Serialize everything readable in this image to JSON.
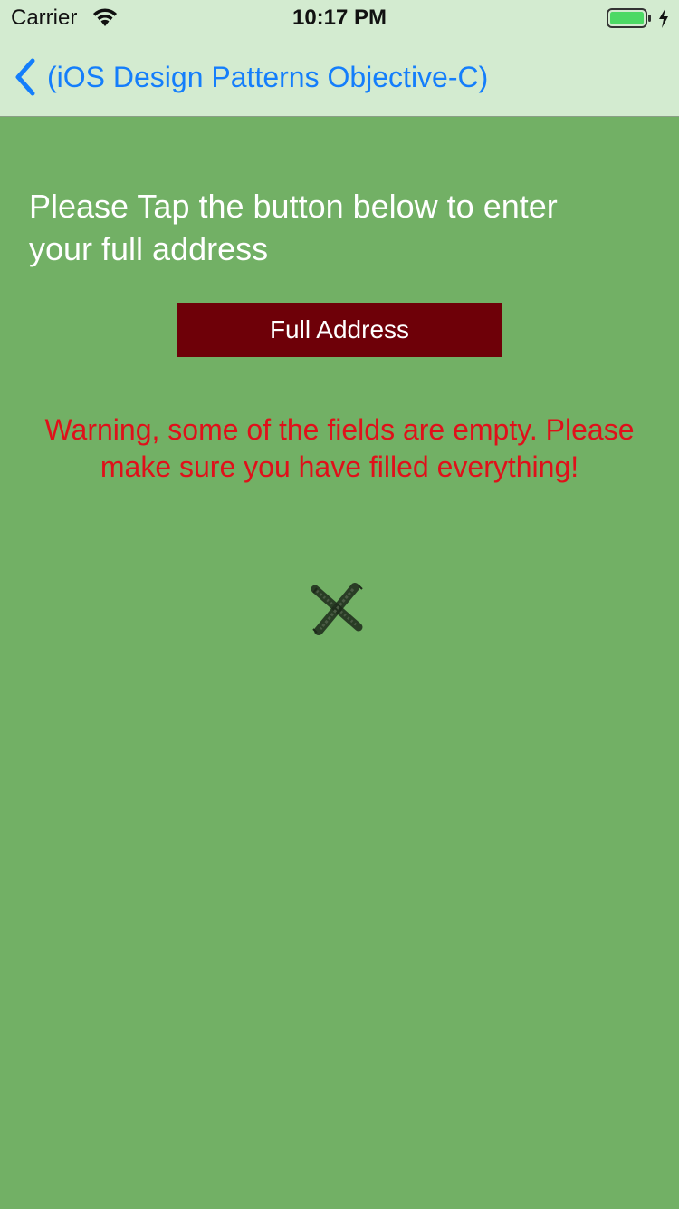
{
  "status_bar": {
    "carrier": "Carrier",
    "time": "10:17 PM",
    "battery_color": "#4cd964"
  },
  "nav_bar": {
    "back_label": "(iOS Design Patterns Objective-C)",
    "tint_color": "#147efb"
  },
  "main": {
    "instruction_text": "Please Tap the button below to enter your full address",
    "full_address_button_label": "Full Address",
    "warning_text": "Warning, some of the fields are empty. Please make sure you have filled everything!",
    "status_icon": "cross-mark-icon"
  },
  "colors": {
    "background": "#72b065",
    "bar_background": "#d3ebd0",
    "button_background": "#6e0008",
    "warning": "#e0101a"
  }
}
